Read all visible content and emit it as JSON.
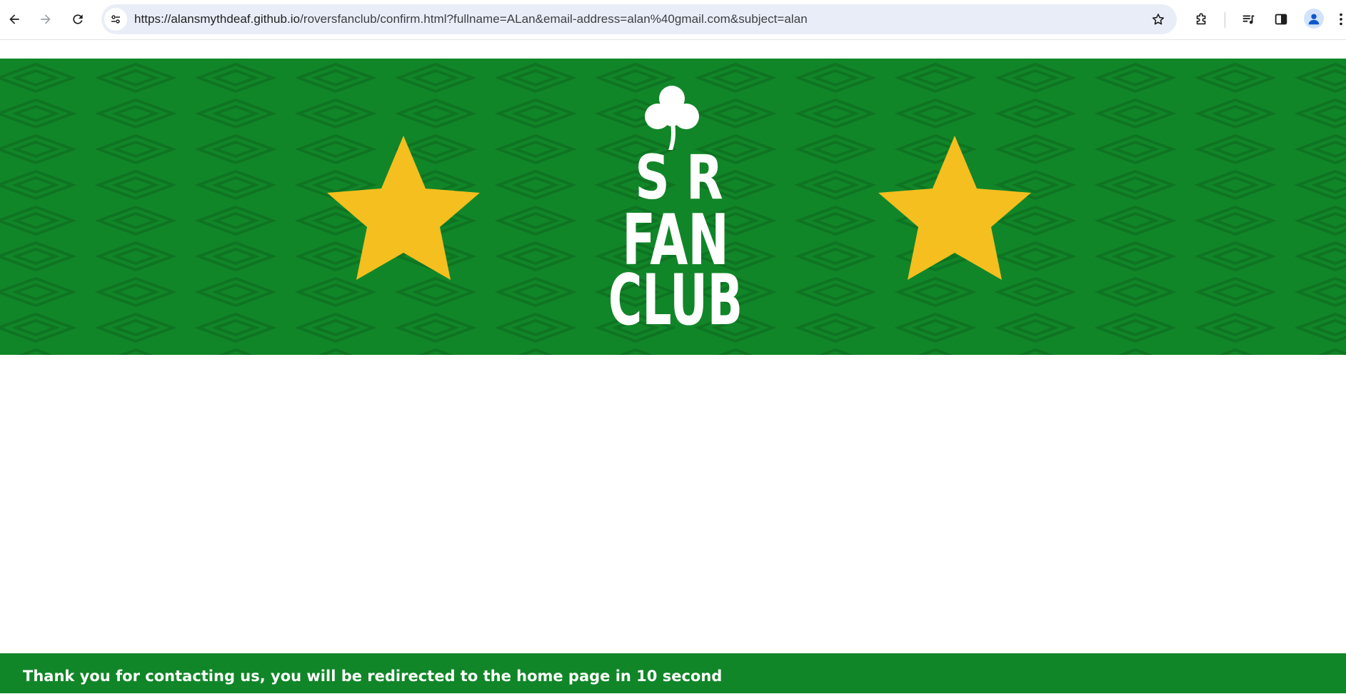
{
  "browser": {
    "url_host": "https://alansmythdeaf.github.io",
    "url_path": "/roversfanclub/confirm.html?fullname=ALan&email-address=alan%40gmail.com&subject=alan",
    "icons": {
      "back": "arrow-left-icon",
      "forward": "arrow-right-icon",
      "reload": "reload-icon",
      "site_info": "tune-icon",
      "bookmark": "star-outline-icon",
      "extensions": "puzzle-icon",
      "media": "playlist-icon",
      "side_panel": "side-panel-icon",
      "profile": "person-icon",
      "menu": "kebab-menu-icon"
    }
  },
  "banner": {
    "logo_text": [
      "S R",
      "FAN",
      "CLUB"
    ],
    "colors": {
      "green": "#118628",
      "star_yellow": "#f4bf1f",
      "logo_white": "#ffffff"
    }
  },
  "footer": {
    "message": "Thank you for contacting us, you will be redirected to the home page in 10 second"
  }
}
